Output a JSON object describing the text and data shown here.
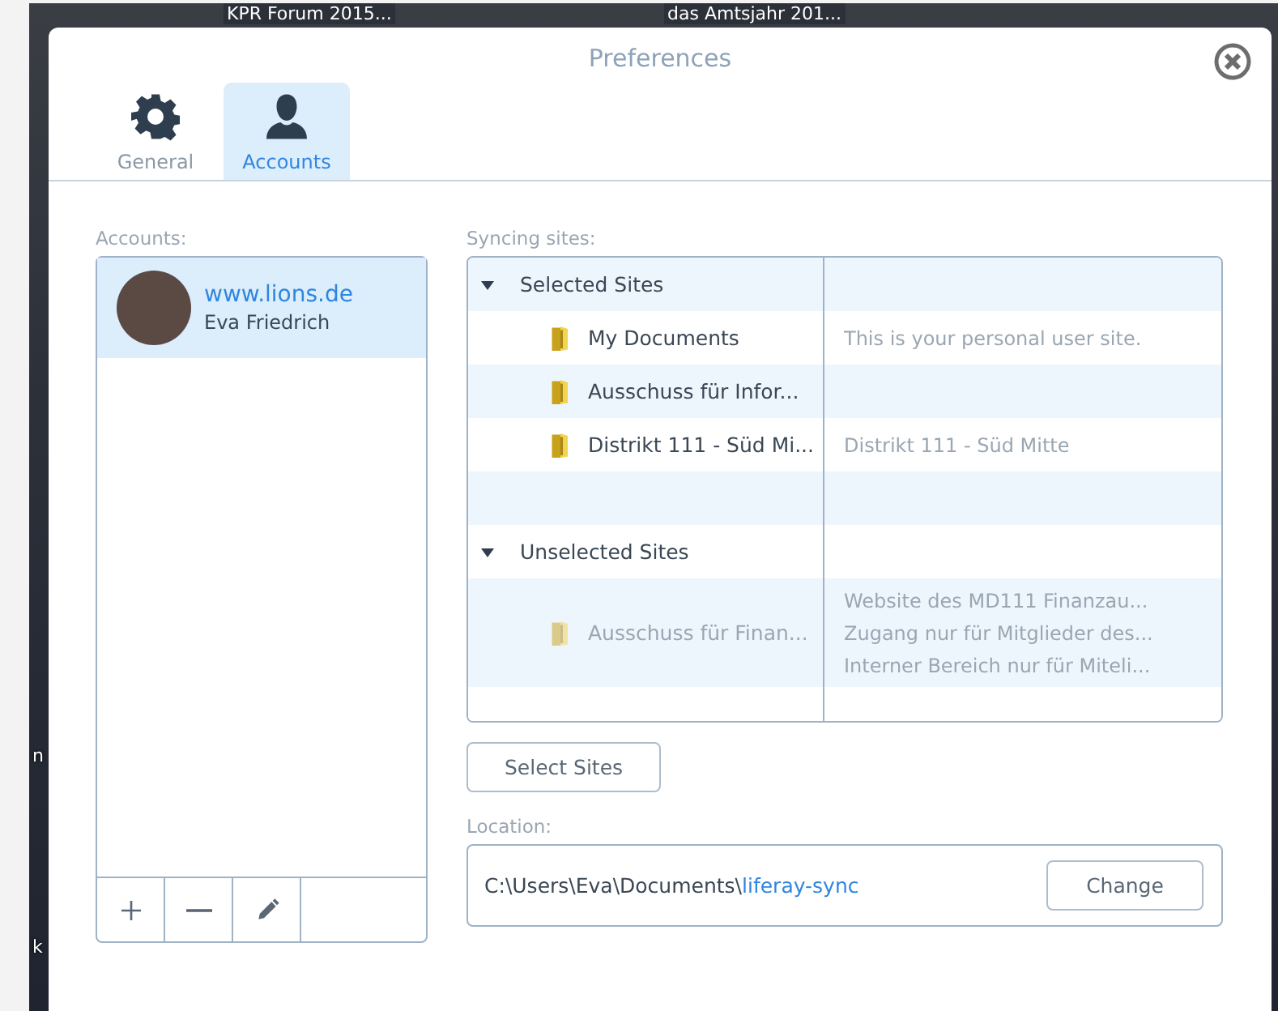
{
  "desktop": {
    "labels": [
      "KPR Forum 2015...",
      "das Amtsjahr 201..."
    ],
    "edge_letters": [
      "n",
      "k"
    ]
  },
  "window": {
    "title": "Preferences"
  },
  "tabs": [
    {
      "label": "General",
      "selected": false
    },
    {
      "label": "Accounts",
      "selected": true
    }
  ],
  "accounts": {
    "label": "Accounts:",
    "items": [
      {
        "site": "www.lions.de",
        "user": "Eva Friedrich",
        "selected": true
      }
    ],
    "toolbar": [
      {
        "kind": "add"
      },
      {
        "kind": "remove"
      },
      {
        "kind": "edit"
      }
    ]
  },
  "syncing": {
    "label": "Syncing sites:",
    "groups": [
      {
        "title": "Selected Sites",
        "expanded": true,
        "children": [
          {
            "name": "My Documents",
            "description": [
              "This is your personal user site."
            ],
            "disabled": false
          },
          {
            "name": "Ausschuss für Infor...",
            "disabled": false
          },
          {
            "name": "Distrikt 111 - Süd Mi...",
            "description": [
              "Distrikt 111 - Süd Mitte"
            ],
            "disabled": false
          }
        ]
      },
      {
        "title": "Unselected Sites",
        "expanded": true,
        "children": [
          {
            "name": "Ausschuss für Finan...",
            "description": [
              "Website des MD111 Finanzau...",
              "Zugang nur für Mitglieder des...",
              "Interner Bereich nur für Miteli..."
            ],
            "disabled": true
          }
        ]
      }
    ],
    "select_button": "Select Sites"
  },
  "location": {
    "label": "Location:",
    "path": "C:\\Users\\Eva\\Documents\\",
    "folder": "liferay-sync",
    "button": "Change"
  }
}
